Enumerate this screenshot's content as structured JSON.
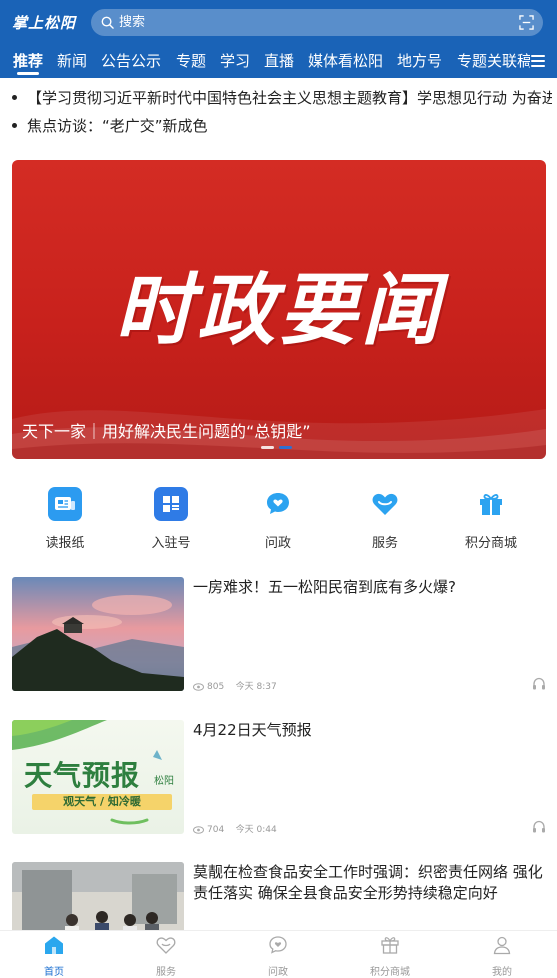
{
  "app": {
    "logo_text": "掌上松阳"
  },
  "search": {
    "placeholder": "搜索"
  },
  "tabs": [
    "推荐",
    "新闻",
    "公告公示",
    "专题",
    "学习",
    "直播",
    "媒体看松阳",
    "地方号",
    "专题关联稿"
  ],
  "ticker": [
    "【学习贯彻习近平新时代中国特色社会主义思想主题教育】学思想见行动 为奋进",
    "焦点访谈：“老广交”新成色"
  ],
  "banner": {
    "headline": "时政要闻",
    "caption": "天下一家｜用好解决民生问题的“总钥匙”",
    "slide_index": 2,
    "slide_count": 2
  },
  "shortcuts": [
    {
      "label": "读报纸",
      "icon": "newspaper-icon"
    },
    {
      "label": "入驻号",
      "icon": "grid-apps-icon"
    },
    {
      "label": "问政",
      "icon": "chat-heart-icon"
    },
    {
      "label": "服务",
      "icon": "heart-icon"
    },
    {
      "label": "积分商城",
      "icon": "gift-icon"
    }
  ],
  "news": [
    {
      "title": "一房难求！五一松阳民宿到底有多火爆?",
      "views": "805",
      "time": "今天 8:37",
      "thumb": "sunset-mountain-image"
    },
    {
      "title": "4月22日天气预报",
      "views": "704",
      "time": "今天 0:44",
      "thumb": "weather-forecast-image",
      "thumb_text": {
        "main": "天气预报",
        "sub": "松阳",
        "tag": "观天气 / 知冷暖"
      }
    },
    {
      "title": "莫靓在检查食品安全工作时强调：织密责任网络 强化责任落实 确保全县食品安全形势持续稳定向好",
      "views": "",
      "time": "",
      "thumb": "inspection-photo-image"
    }
  ],
  "bottom_nav": [
    {
      "label": "首页",
      "icon": "home-icon",
      "active": true
    },
    {
      "label": "服务",
      "icon": "heart-outline-icon"
    },
    {
      "label": "问政",
      "icon": "chat-heart-outline-icon"
    },
    {
      "label": "积分商城",
      "icon": "gift-outline-icon"
    },
    {
      "label": "我的",
      "icon": "user-icon"
    }
  ],
  "colors": {
    "brand": "#1a63b7",
    "banner_red": "#d42c24",
    "accent_blue": "#1b6fd0"
  }
}
